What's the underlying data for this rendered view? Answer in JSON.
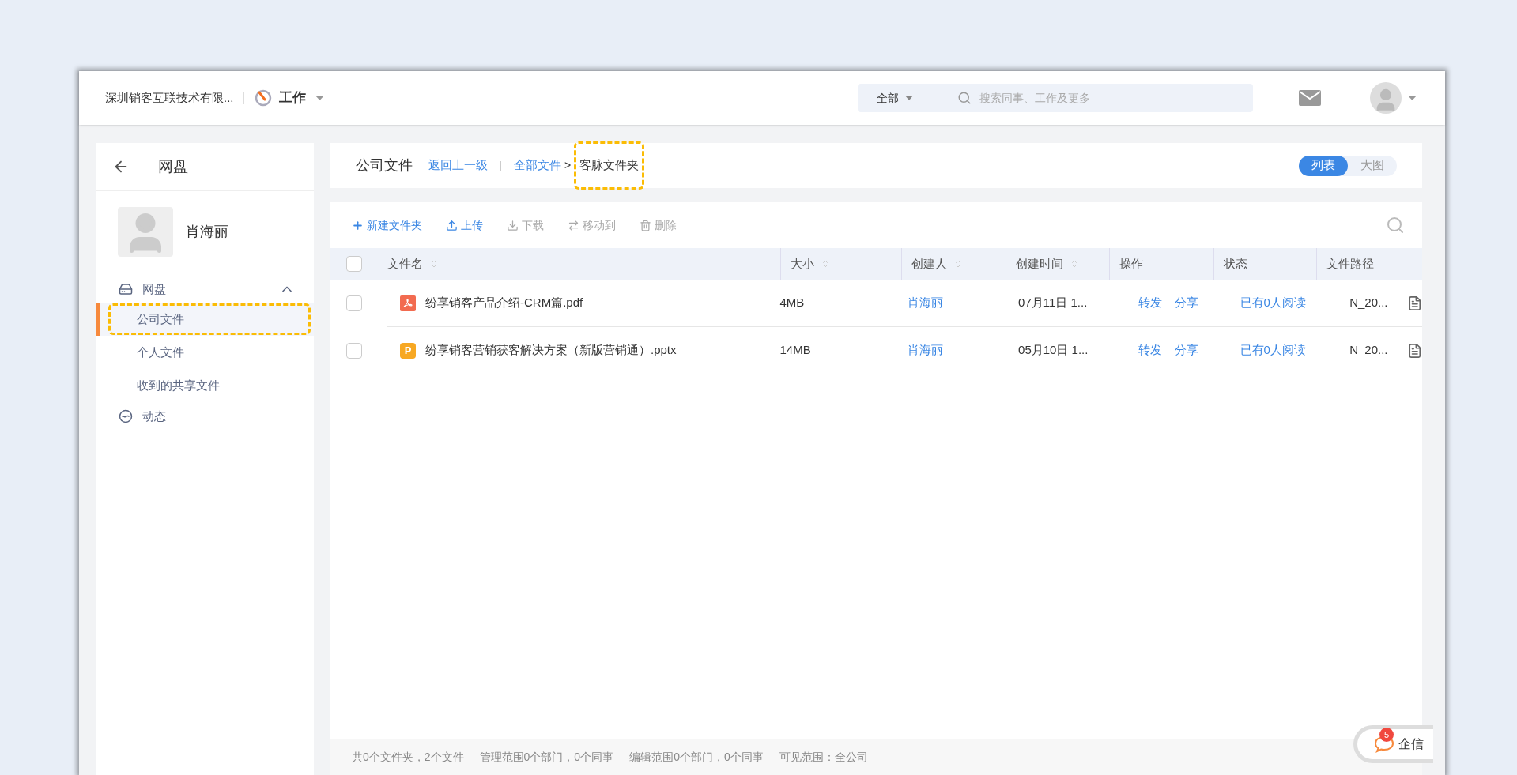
{
  "topbar": {
    "company": "深圳销客互联技术有限...",
    "app": "工作",
    "search_scope": "全部",
    "search_placeholder": "搜索同事、工作及更多"
  },
  "sidebar": {
    "title": "网盘",
    "user": "肖海丽",
    "items": [
      {
        "label": "网盘",
        "kind": "group",
        "expanded": true,
        "children": [
          {
            "label": "公司文件",
            "selected": true,
            "highlighted": true
          },
          {
            "label": "个人文件",
            "selected": false,
            "highlighted": false
          },
          {
            "label": "收到的共享文件",
            "selected": false,
            "highlighted": false
          }
        ]
      },
      {
        "label": "动态",
        "kind": "link"
      }
    ]
  },
  "header": {
    "title": "公司文件",
    "back_link": "返回上一级",
    "crumbs": [
      {
        "label": "全部文件",
        "kind": "link",
        "highlighted": false
      },
      {
        "label": "客脉文件夹",
        "kind": "current",
        "highlighted": true
      }
    ],
    "crumb_sep": ">",
    "views": [
      {
        "label": "列表",
        "selected": true
      },
      {
        "label": "大图",
        "selected": false
      }
    ]
  },
  "toolbar": [
    {
      "label": "新建文件夹",
      "disabled": false
    },
    {
      "label": "上传",
      "disabled": false
    },
    {
      "label": "下载",
      "disabled": true
    },
    {
      "label": "移动到",
      "disabled": true
    },
    {
      "label": "删除",
      "disabled": true
    }
  ],
  "table": {
    "all_checked": false,
    "columns": [
      {
        "label": "文件名",
        "sortable": true
      },
      {
        "label": "大小",
        "sortable": true
      },
      {
        "label": "创建人",
        "sortable": true
      },
      {
        "label": "创建时间",
        "sortable": true
      },
      {
        "label": "操作",
        "sortable": false
      },
      {
        "label": "状态",
        "sortable": false
      },
      {
        "label": "文件路径",
        "sortable": false
      }
    ],
    "rows": [
      {
        "checked": false,
        "kind": "pdf",
        "name": "纷享销客产品介绍-CRM篇.pdf",
        "size": "4MB",
        "creator": "肖海丽",
        "time": "07月11日 1...",
        "actions": [
          "转发",
          "分享"
        ],
        "status": "已有0人阅读",
        "path": "N_20..."
      },
      {
        "checked": false,
        "kind": "ppt",
        "type_letter": "P",
        "name": "纷享销客营销获客解决方案（新版营销通）.pptx",
        "size": "14MB",
        "creator": "肖海丽",
        "time": "05月10日 1...",
        "actions": [
          "转发",
          "分享"
        ],
        "status": "已有0人阅读",
        "path": "N_20..."
      }
    ]
  },
  "status_bar": [
    "共0个文件夹，2个文件",
    "管理范围0个部门，0个同事",
    "编辑范围0个部门，0个同事",
    "可见范围：全公司"
  ],
  "chat": {
    "label": "企信",
    "badge": "5"
  }
}
